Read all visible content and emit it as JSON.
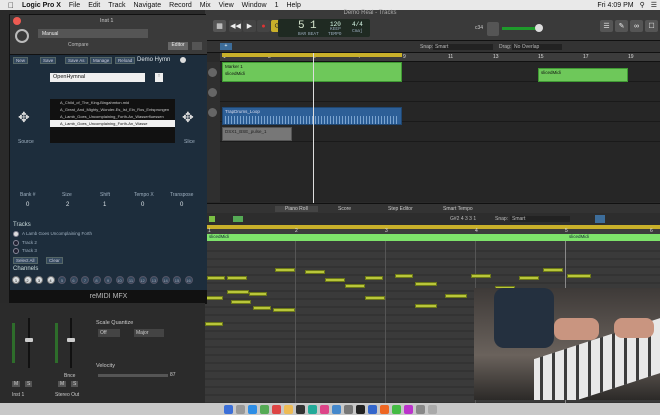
{
  "menubar": {
    "items": [
      "Logic Pro X",
      "File",
      "Edit",
      "Track",
      "Navigate",
      "Record",
      "Mix",
      "View",
      "Window",
      "1",
      "Help"
    ],
    "clock": "Fri 4:09 PM"
  },
  "window": {
    "title": "Demo Real - Tracks"
  },
  "lcd": {
    "bar": "5",
    "beat": "1",
    "bar_label": "BAR",
    "beat_label": "BEAT",
    "tempo": "120",
    "tempo_label": "TEMPO",
    "tempo_mode": "KEEP",
    "signature": "4/4",
    "key": "Cmaj"
  },
  "tracks_header": {
    "snap_label": "Snap:",
    "snap_value": "Smart",
    "drag_label": "Drag:",
    "drag_value": "No Overlap"
  },
  "ruler": {
    "marks": [
      "1",
      "3",
      "5",
      "7",
      "9",
      "11",
      "13",
      "15",
      "17",
      "19"
    ]
  },
  "regions": [
    {
      "name": "Marker 1",
      "lane": 0
    },
    {
      "name": "slicedMidi",
      "lane": 0
    },
    {
      "name": "slicedMidi",
      "lane": 0
    },
    {
      "name": "TrapDrums_Loop",
      "lane": 1
    },
    {
      "name": "DSX1_BSE_pulse_1",
      "lane": 2
    }
  ],
  "piano_roll": {
    "tabs": [
      "Piano Roll",
      "Score",
      "Step Editor",
      "Smart Tempo"
    ],
    "position": "G#2  4 3 3 1",
    "snap_label": "Snap:",
    "snap_value": "Smart",
    "ruler_marks": [
      "1",
      "2",
      "3",
      "4",
      "5",
      "6"
    ],
    "region_label": "slicedMidi",
    "key_label": "C3"
  },
  "plugin": {
    "title": "Inst 1",
    "preset": "Manual",
    "compare": "Compare",
    "editor": "Editor",
    "toolbar": [
      "New",
      "Save",
      "Save As",
      "Manage",
      "Reload"
    ],
    "preset_name": "Demo Hymn",
    "library": "OpenHymnal",
    "files": [
      "A_Child_of_The_King-Bingahmton.mid",
      "A_Great_And_Mighty_Wonder-Es_Ist_Ein_Ros_Entsprungen",
      "A_Lamb_Goes_Uncomplaining_Forth-An_Wasserfluessen",
      "A_Lamb_Goes_Uncomplaining_Forth-An_Wasse"
    ],
    "left_label": "Source",
    "right_label": "Slice",
    "params": [
      {
        "label": "Bank #",
        "value": "0"
      },
      {
        "label": "Size",
        "value": "2"
      },
      {
        "label": "Shift",
        "value": "1"
      },
      {
        "label": "Tempo X",
        "value": "0"
      },
      {
        "label": "Transpose",
        "value": "0"
      }
    ],
    "tracks_title": "Tracks",
    "track_items": [
      "A Lamb Goes Uncomplaining Forth",
      "Track 2",
      "Track 3"
    ],
    "select_all": "Select All",
    "clear": "Clear",
    "channels_title": "Channels",
    "channels": [
      "1",
      "2",
      "3",
      "4",
      "5",
      "6",
      "7",
      "8",
      "9",
      "10",
      "11",
      "12",
      "13",
      "14",
      "15",
      "16"
    ],
    "footer": "reMIDI MFX"
  },
  "mixer": {
    "strip1": "Inst 1",
    "strip2": "Stereo Out",
    "bnc": "Bnce",
    "quantize_label": "Scale Quantize",
    "quantize_off": "Off",
    "quantize_scale": "Major",
    "velocity_label": "Velocity",
    "velocity_value": "87",
    "m": "M",
    "s": "S"
  },
  "colors": {
    "midi_region": "#6ec85a",
    "audio_region": "#2d5f97",
    "note": "#b9c63b",
    "cycle": "#c9b02a"
  }
}
